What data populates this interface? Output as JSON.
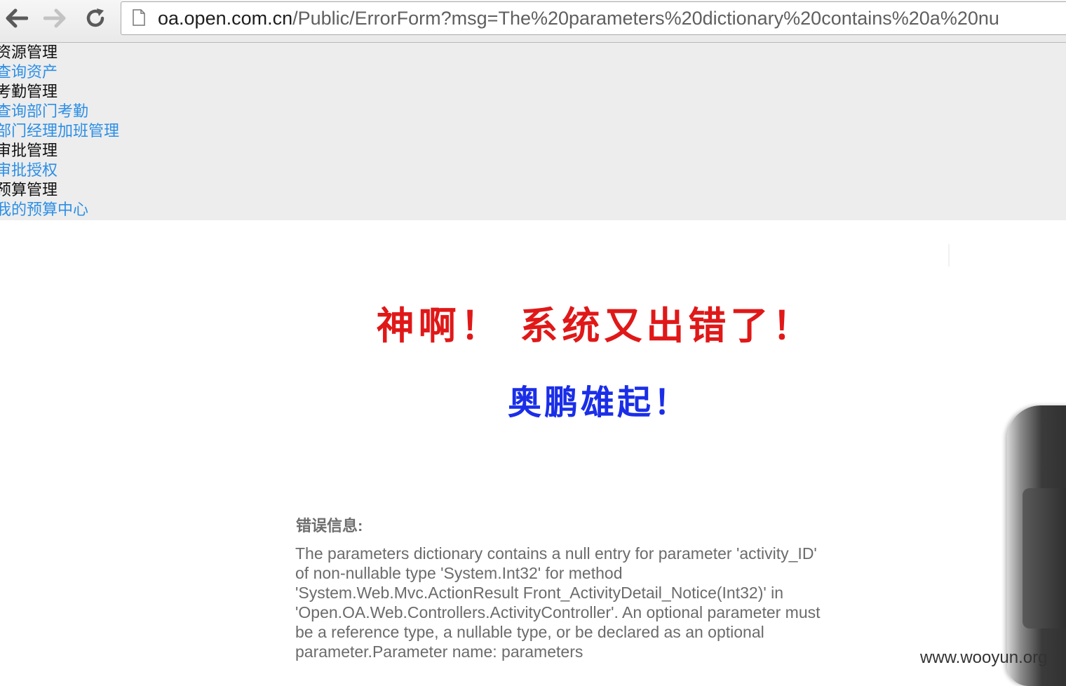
{
  "browser": {
    "url_host": "oa.open.com.cn",
    "url_path": "/Public/ErrorForm?msg=The%20parameters%20dictionary%20contains%20a%20nu",
    "icons": {
      "back": "arrow-left-icon",
      "forward": "arrow-right-icon",
      "reload": "reload-icon",
      "page": "page-icon"
    }
  },
  "menu": {
    "items": [
      {
        "label": "资源管理",
        "type": "heading"
      },
      {
        "label": "查询资产",
        "type": "link"
      },
      {
        "label": "考勤管理",
        "type": "heading"
      },
      {
        "label": "查询部门考勤",
        "type": "link"
      },
      {
        "label": "部门经理加班管理",
        "type": "link"
      },
      {
        "label": "审批管理",
        "type": "heading"
      },
      {
        "label": "审批授权",
        "type": "link"
      },
      {
        "label": "预算管理",
        "type": "heading"
      },
      {
        "label": "我的预算中心",
        "type": "link"
      }
    ]
  },
  "banner": {
    "main": "神啊！ 系统又出错了！",
    "sub": "奥鹏雄起！",
    "main_color": "#e01818",
    "sub_color": "#1a2ee8"
  },
  "error": {
    "label": "错误信息:",
    "lines": [
      "The parameters dictionary contains a null entry for parameter 'activity_ID'",
      "of non-nullable type 'System.Int32' for method",
      "'System.Web.Mvc.ActionResult Front_ActivityDetail_Notice(Int32)' in",
      "'Open.OA.Web.Controllers.ActivityController'. An optional parameter must",
      "be a reference type, a nullable type, or be declared as an optional",
      "parameter.Parameter name: parameters"
    ]
  },
  "watermark": "www.wooyun.org",
  "colors": {
    "link": "#2c8fe6",
    "menu_bg": "#ededed"
  }
}
